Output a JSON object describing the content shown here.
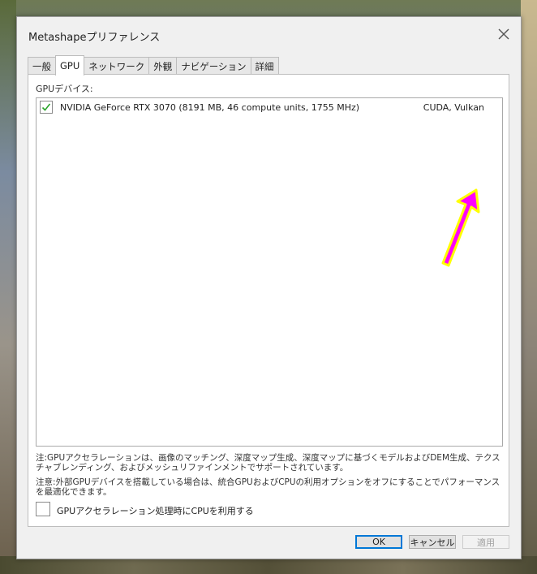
{
  "window": {
    "title": "Metashapeプリファレンス"
  },
  "tabs": [
    {
      "label": "一般",
      "active": false
    },
    {
      "label": "GPU",
      "active": true
    },
    {
      "label": "ネットワーク",
      "active": false
    },
    {
      "label": "外観",
      "active": false
    },
    {
      "label": "ナビゲーション",
      "active": false
    },
    {
      "label": "詳細",
      "active": false
    }
  ],
  "gpu": {
    "section_label": "GPUデバイス:",
    "devices": [
      {
        "checked": true,
        "name": "NVIDIA GeForce RTX 3070 (8191 MB, 46 compute units, 1755 MHz)",
        "api": "CUDA, Vulkan"
      }
    ],
    "note1": "注:GPUアクセラレーションは、画像のマッチング、深度マップ生成、深度マップに基づくモデルおよびDEM生成、テクスチャブレンディング、およびメッシュリファインメントでサポートされています。",
    "note2": "注意:外部GPUデバイスを搭載している場合は、統合GPUおよびCPUの利用オプションをオフにすることでパフォーマンスを最適化できます。",
    "cpu_option": {
      "checked": false,
      "label": "GPUアクセラレーション処理時にCPUを利用する"
    }
  },
  "buttons": {
    "ok": "OK",
    "cancel": "キャンセル",
    "apply": "適用"
  },
  "annotation": {
    "arrow_color": "#ff00ff",
    "arrow_outline": "#ffff00"
  },
  "icons": {
    "close": "close-icon",
    "check": "check-icon",
    "arrow": "arrow-icon"
  }
}
